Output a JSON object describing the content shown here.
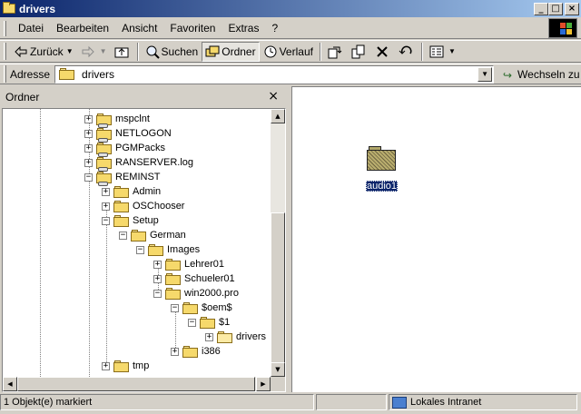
{
  "window": {
    "title": "drivers"
  },
  "titlebar_buttons": {
    "minimize": "_",
    "maximize": "□",
    "close": "×"
  },
  "menu": [
    "Datei",
    "Bearbeiten",
    "Ansicht",
    "Favoriten",
    "Extras",
    "?"
  ],
  "toolbar": {
    "back_label": "Zurück",
    "search_label": "Suchen",
    "folders_label": "Ordner",
    "history_label": "Verlauf"
  },
  "address": {
    "label": "Adresse",
    "value": "drivers",
    "go_label": "Wechseln zu"
  },
  "folder_pane": {
    "title": "Ordner",
    "close": "×",
    "items": [
      {
        "label": "mspclnt",
        "expander": "+",
        "type": "share"
      },
      {
        "label": "NETLOGON",
        "expander": "+",
        "type": "share"
      },
      {
        "label": "PGMPacks",
        "expander": "+",
        "type": "share"
      },
      {
        "label": "RANSERVER.log",
        "expander": "+",
        "type": "share"
      },
      {
        "label": "REMINST",
        "expander": "−",
        "type": "share"
      },
      {
        "label": "Admin",
        "expander": "+",
        "type": "folder"
      },
      {
        "label": "OSChooser",
        "expander": "+",
        "type": "folder"
      },
      {
        "label": "Setup",
        "expander": "−",
        "type": "folder"
      },
      {
        "label": "German",
        "expander": "−",
        "type": "folder"
      },
      {
        "label": "Images",
        "expander": "−",
        "type": "folder"
      },
      {
        "label": "Lehrer01",
        "expander": "+",
        "type": "folder"
      },
      {
        "label": "Schueler01",
        "expander": "+",
        "type": "folder"
      },
      {
        "label": "win2000.pro",
        "expander": "−",
        "type": "folder"
      },
      {
        "label": "$oem$",
        "expander": "−",
        "type": "folder"
      },
      {
        "label": "$1",
        "expander": "−",
        "type": "folder"
      },
      {
        "label": "drivers",
        "expander": "+",
        "type": "open"
      },
      {
        "label": "i386",
        "expander": "+",
        "type": "folder"
      },
      {
        "label": "tmp",
        "expander": "+",
        "type": "folder"
      }
    ]
  },
  "content": {
    "items": [
      {
        "label": "audio1",
        "selected": true
      }
    ]
  },
  "status": {
    "selection": "1 Objekt(e) markiert",
    "zone": "Lokales Intranet"
  },
  "colors": {
    "titlebar_start": "#0a246a",
    "titlebar_end": "#a6caf0",
    "selection": "#0a246a",
    "chrome": "#d4d0c8"
  }
}
